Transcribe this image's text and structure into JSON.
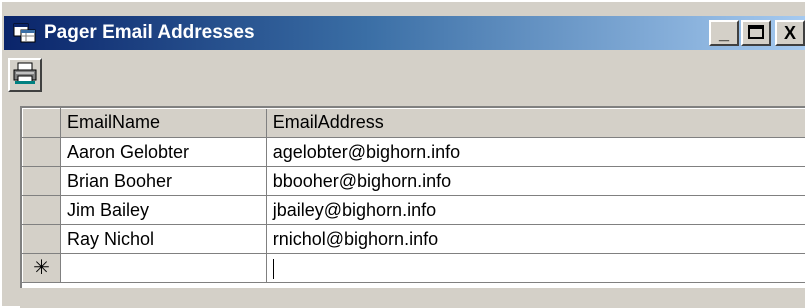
{
  "window": {
    "title": "Pager Email Addresses",
    "icon": "datasheet-icon",
    "minimize_label": "_",
    "maximize_label": "□",
    "close_label": "X"
  },
  "toolbar": {
    "print_icon": "printer-icon"
  },
  "grid": {
    "columns": [
      "EmailName",
      "EmailAddress"
    ],
    "rows": [
      {
        "name": "Aaron Gelobter",
        "address": "agelobter@bighorn.info"
      },
      {
        "name": "Brian Booher",
        "address": "bbooher@bighorn.info"
      },
      {
        "name": "Jim Bailey",
        "address": "jbailey@bighorn.info"
      },
      {
        "name": "Ray Nichol",
        "address": "rnichol@bighorn.info"
      }
    ],
    "new_row_marker": "✳"
  },
  "colors": {
    "title_start": "#0a246a",
    "title_end": "#a6caf0",
    "face": "#d4d0c8"
  }
}
